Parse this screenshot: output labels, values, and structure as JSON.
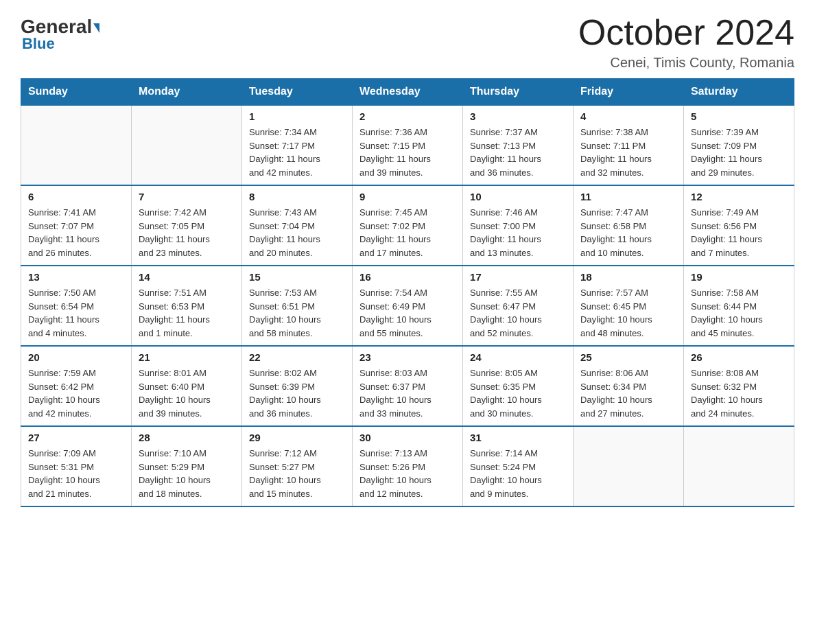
{
  "header": {
    "logo_general": "General",
    "logo_blue": "Blue",
    "month_title": "October 2024",
    "location": "Cenei, Timis County, Romania"
  },
  "days_of_week": [
    "Sunday",
    "Monday",
    "Tuesday",
    "Wednesday",
    "Thursday",
    "Friday",
    "Saturday"
  ],
  "weeks": [
    [
      {
        "day": "",
        "info": ""
      },
      {
        "day": "",
        "info": ""
      },
      {
        "day": "1",
        "info": "Sunrise: 7:34 AM\nSunset: 7:17 PM\nDaylight: 11 hours\nand 42 minutes."
      },
      {
        "day": "2",
        "info": "Sunrise: 7:36 AM\nSunset: 7:15 PM\nDaylight: 11 hours\nand 39 minutes."
      },
      {
        "day": "3",
        "info": "Sunrise: 7:37 AM\nSunset: 7:13 PM\nDaylight: 11 hours\nand 36 minutes."
      },
      {
        "day": "4",
        "info": "Sunrise: 7:38 AM\nSunset: 7:11 PM\nDaylight: 11 hours\nand 32 minutes."
      },
      {
        "day": "5",
        "info": "Sunrise: 7:39 AM\nSunset: 7:09 PM\nDaylight: 11 hours\nand 29 minutes."
      }
    ],
    [
      {
        "day": "6",
        "info": "Sunrise: 7:41 AM\nSunset: 7:07 PM\nDaylight: 11 hours\nand 26 minutes."
      },
      {
        "day": "7",
        "info": "Sunrise: 7:42 AM\nSunset: 7:05 PM\nDaylight: 11 hours\nand 23 minutes."
      },
      {
        "day": "8",
        "info": "Sunrise: 7:43 AM\nSunset: 7:04 PM\nDaylight: 11 hours\nand 20 minutes."
      },
      {
        "day": "9",
        "info": "Sunrise: 7:45 AM\nSunset: 7:02 PM\nDaylight: 11 hours\nand 17 minutes."
      },
      {
        "day": "10",
        "info": "Sunrise: 7:46 AM\nSunset: 7:00 PM\nDaylight: 11 hours\nand 13 minutes."
      },
      {
        "day": "11",
        "info": "Sunrise: 7:47 AM\nSunset: 6:58 PM\nDaylight: 11 hours\nand 10 minutes."
      },
      {
        "day": "12",
        "info": "Sunrise: 7:49 AM\nSunset: 6:56 PM\nDaylight: 11 hours\nand 7 minutes."
      }
    ],
    [
      {
        "day": "13",
        "info": "Sunrise: 7:50 AM\nSunset: 6:54 PM\nDaylight: 11 hours\nand 4 minutes."
      },
      {
        "day": "14",
        "info": "Sunrise: 7:51 AM\nSunset: 6:53 PM\nDaylight: 11 hours\nand 1 minute."
      },
      {
        "day": "15",
        "info": "Sunrise: 7:53 AM\nSunset: 6:51 PM\nDaylight: 10 hours\nand 58 minutes."
      },
      {
        "day": "16",
        "info": "Sunrise: 7:54 AM\nSunset: 6:49 PM\nDaylight: 10 hours\nand 55 minutes."
      },
      {
        "day": "17",
        "info": "Sunrise: 7:55 AM\nSunset: 6:47 PM\nDaylight: 10 hours\nand 52 minutes."
      },
      {
        "day": "18",
        "info": "Sunrise: 7:57 AM\nSunset: 6:45 PM\nDaylight: 10 hours\nand 48 minutes."
      },
      {
        "day": "19",
        "info": "Sunrise: 7:58 AM\nSunset: 6:44 PM\nDaylight: 10 hours\nand 45 minutes."
      }
    ],
    [
      {
        "day": "20",
        "info": "Sunrise: 7:59 AM\nSunset: 6:42 PM\nDaylight: 10 hours\nand 42 minutes."
      },
      {
        "day": "21",
        "info": "Sunrise: 8:01 AM\nSunset: 6:40 PM\nDaylight: 10 hours\nand 39 minutes."
      },
      {
        "day": "22",
        "info": "Sunrise: 8:02 AM\nSunset: 6:39 PM\nDaylight: 10 hours\nand 36 minutes."
      },
      {
        "day": "23",
        "info": "Sunrise: 8:03 AM\nSunset: 6:37 PM\nDaylight: 10 hours\nand 33 minutes."
      },
      {
        "day": "24",
        "info": "Sunrise: 8:05 AM\nSunset: 6:35 PM\nDaylight: 10 hours\nand 30 minutes."
      },
      {
        "day": "25",
        "info": "Sunrise: 8:06 AM\nSunset: 6:34 PM\nDaylight: 10 hours\nand 27 minutes."
      },
      {
        "day": "26",
        "info": "Sunrise: 8:08 AM\nSunset: 6:32 PM\nDaylight: 10 hours\nand 24 minutes."
      }
    ],
    [
      {
        "day": "27",
        "info": "Sunrise: 7:09 AM\nSunset: 5:31 PM\nDaylight: 10 hours\nand 21 minutes."
      },
      {
        "day": "28",
        "info": "Sunrise: 7:10 AM\nSunset: 5:29 PM\nDaylight: 10 hours\nand 18 minutes."
      },
      {
        "day": "29",
        "info": "Sunrise: 7:12 AM\nSunset: 5:27 PM\nDaylight: 10 hours\nand 15 minutes."
      },
      {
        "day": "30",
        "info": "Sunrise: 7:13 AM\nSunset: 5:26 PM\nDaylight: 10 hours\nand 12 minutes."
      },
      {
        "day": "31",
        "info": "Sunrise: 7:14 AM\nSunset: 5:24 PM\nDaylight: 10 hours\nand 9 minutes."
      },
      {
        "day": "",
        "info": ""
      },
      {
        "day": "",
        "info": ""
      }
    ]
  ]
}
